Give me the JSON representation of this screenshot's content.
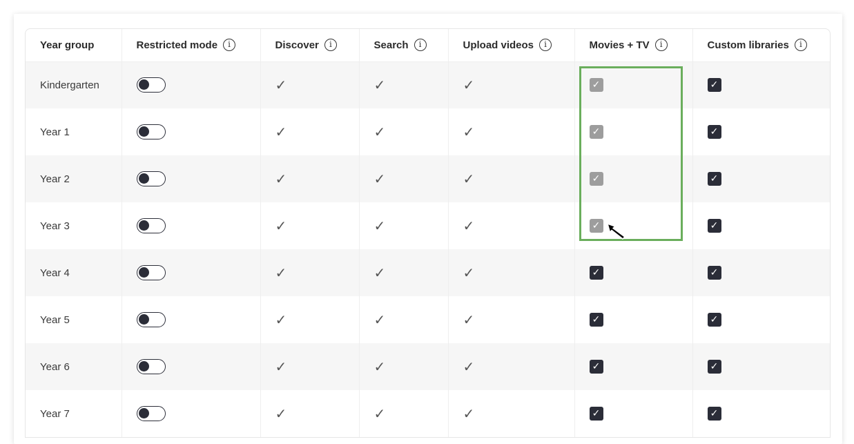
{
  "table": {
    "headers": [
      {
        "label": "Year group",
        "info": false
      },
      {
        "label": "Restricted mode",
        "info": true
      },
      {
        "label": "Discover",
        "info": true
      },
      {
        "label": "Search",
        "info": true
      },
      {
        "label": "Upload videos",
        "info": true
      },
      {
        "label": "Movies + TV",
        "info": true
      },
      {
        "label": "Custom libraries",
        "info": true
      }
    ],
    "info_glyph": "i",
    "tick_glyph": "✓",
    "checkbox_glyph": "✓",
    "rows": [
      {
        "year": "Kindergarten",
        "restricted_mode": false,
        "discover": true,
        "search": true,
        "upload": true,
        "movies_tv": "checked-disabled",
        "custom_libraries": "checked"
      },
      {
        "year": "Year 1",
        "restricted_mode": false,
        "discover": true,
        "search": true,
        "upload": true,
        "movies_tv": "checked-disabled",
        "custom_libraries": "checked"
      },
      {
        "year": "Year 2",
        "restricted_mode": false,
        "discover": true,
        "search": true,
        "upload": true,
        "movies_tv": "checked-disabled",
        "custom_libraries": "checked"
      },
      {
        "year": "Year 3",
        "restricted_mode": false,
        "discover": true,
        "search": true,
        "upload": true,
        "movies_tv": "checked-disabled",
        "custom_libraries": "checked"
      },
      {
        "year": "Year 4",
        "restricted_mode": false,
        "discover": true,
        "search": true,
        "upload": true,
        "movies_tv": "checked",
        "custom_libraries": "checked"
      },
      {
        "year": "Year 5",
        "restricted_mode": false,
        "discover": true,
        "search": true,
        "upload": true,
        "movies_tv": "checked",
        "custom_libraries": "checked"
      },
      {
        "year": "Year 6",
        "restricted_mode": false,
        "discover": true,
        "search": true,
        "upload": true,
        "movies_tv": "checked",
        "custom_libraries": "checked"
      },
      {
        "year": "Year 7",
        "restricted_mode": false,
        "discover": true,
        "search": true,
        "upload": true,
        "movies_tv": "checked",
        "custom_libraries": "checked"
      }
    ]
  },
  "icons": {
    "info": "info-circle-icon",
    "tick": "checkmark-icon",
    "cursor": "mouse-pointer-icon"
  },
  "colors": {
    "dark_control": "#2b2d38",
    "disabled_checkbox": "#9d9d9d",
    "highlight": "#6aae5c",
    "row_shade": "#f6f6f6"
  }
}
